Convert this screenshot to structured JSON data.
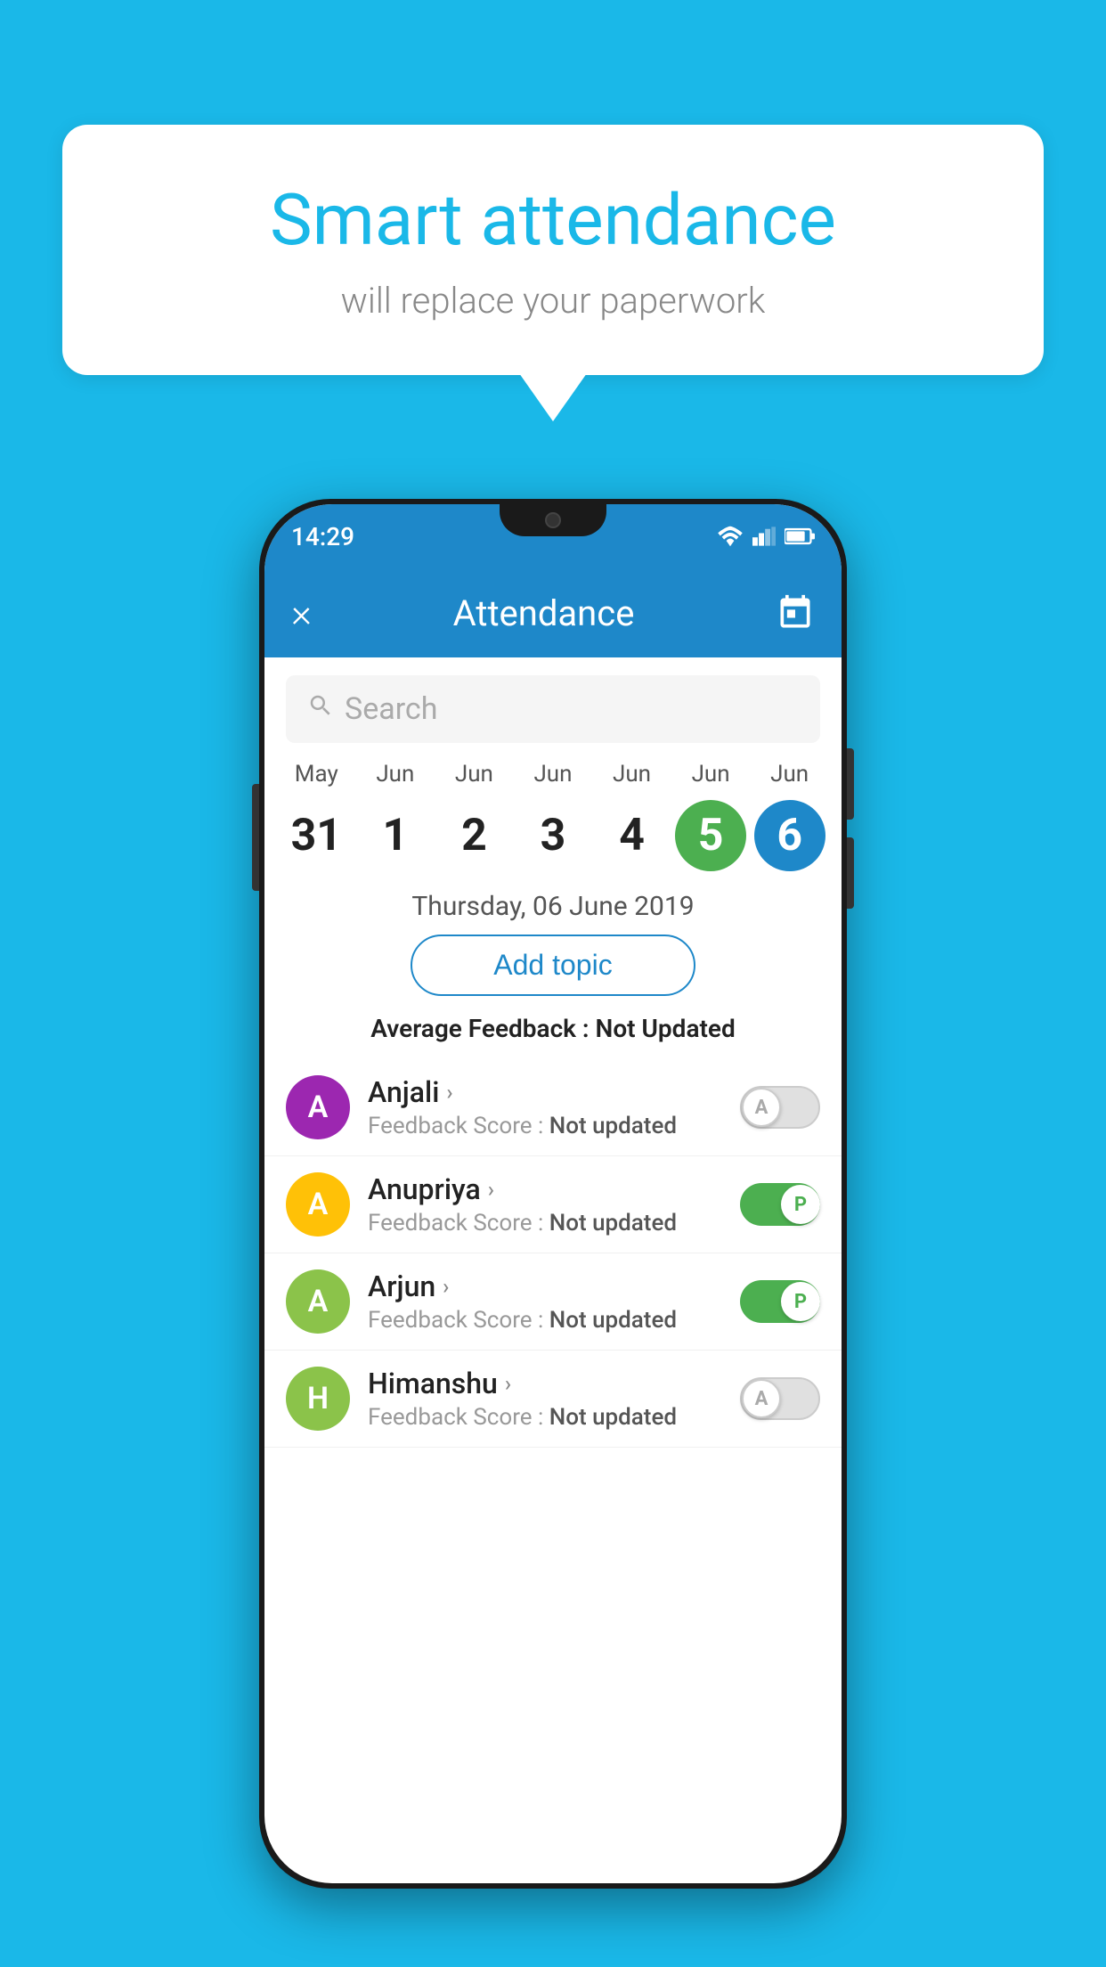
{
  "background_color": "#1ab8e8",
  "speech_bubble": {
    "title": "Smart attendance",
    "subtitle": "will replace your paperwork"
  },
  "status_bar": {
    "time": "14:29"
  },
  "app_bar": {
    "title": "Attendance",
    "close_label": "×",
    "calendar_label": "📅"
  },
  "search": {
    "placeholder": "Search"
  },
  "calendar": {
    "days": [
      {
        "month": "May",
        "date": "31",
        "state": "normal"
      },
      {
        "month": "Jun",
        "date": "1",
        "state": "normal"
      },
      {
        "month": "Jun",
        "date": "2",
        "state": "normal"
      },
      {
        "month": "Jun",
        "date": "3",
        "state": "normal"
      },
      {
        "month": "Jun",
        "date": "4",
        "state": "normal"
      },
      {
        "month": "Jun",
        "date": "5",
        "state": "today"
      },
      {
        "month": "Jun",
        "date": "6",
        "state": "selected"
      }
    ]
  },
  "date_header": "Thursday, 06 June 2019",
  "add_topic_label": "Add topic",
  "avg_feedback": {
    "label": "Average Feedback : ",
    "value": "Not Updated"
  },
  "students": [
    {
      "name": "Anjali",
      "avatar_letter": "A",
      "avatar_color": "#9c27b0",
      "feedback": "Feedback Score : ",
      "feedback_value": "Not updated",
      "toggle_state": "off",
      "toggle_letter": "A"
    },
    {
      "name": "Anupriya",
      "avatar_letter": "A",
      "avatar_color": "#ffc107",
      "feedback": "Feedback Score : ",
      "feedback_value": "Not updated",
      "toggle_state": "on",
      "toggle_letter": "P"
    },
    {
      "name": "Arjun",
      "avatar_letter": "A",
      "avatar_color": "#8bc34a",
      "feedback": "Feedback Score : ",
      "feedback_value": "Not updated",
      "toggle_state": "on",
      "toggle_letter": "P"
    },
    {
      "name": "Himanshu",
      "avatar_letter": "H",
      "avatar_color": "#8bc34a",
      "feedback": "Feedback Score : ",
      "feedback_value": "Not updated",
      "toggle_state": "off",
      "toggle_letter": "A"
    }
  ]
}
